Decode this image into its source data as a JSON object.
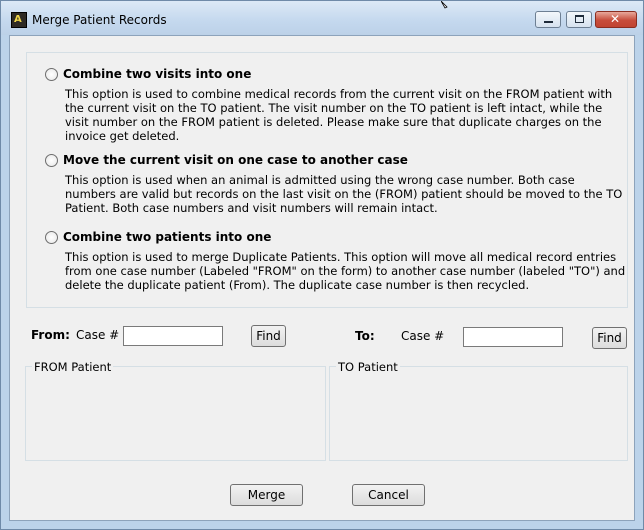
{
  "window": {
    "title": "Merge Patient Records"
  },
  "options": [
    {
      "label": "Combine two visits into one",
      "description": "This option is used to combine medical records from the current visit on the FROM patient with the current visit on the TO patient. The visit number on the TO patient is left intact, while the visit number on the FROM patient is deleted.  Please make sure that duplicate charges on the invoice get deleted."
    },
    {
      "label": "Move the current visit on one case to another case",
      "description": "This option is used when an animal is admitted using the wrong case number.  Both case numbers are valid but records on the last visit on the (FROM) patient should be moved to the TO Patient.  Both case numbers and visit numbers will remain intact."
    },
    {
      "label": "Combine two patients into one",
      "description": "This option is used to merge Duplicate Patients.  This option will move all medical record entries from one case number (Labeled \"FROM\" on the form) to another case number (labeled \"TO\") and delete the duplicate patient (From).  The duplicate case number is then recycled."
    }
  ],
  "from": {
    "label": "From:",
    "case_label": "Case #",
    "case_value": "",
    "find_label": "Find",
    "group_title": "FROM Patient"
  },
  "to": {
    "label": "To:",
    "case_label": "Case #",
    "case_value": "",
    "find_label": "Find",
    "group_title": "TO Patient"
  },
  "actions": {
    "merge_label": "Merge",
    "cancel_label": "Cancel"
  }
}
